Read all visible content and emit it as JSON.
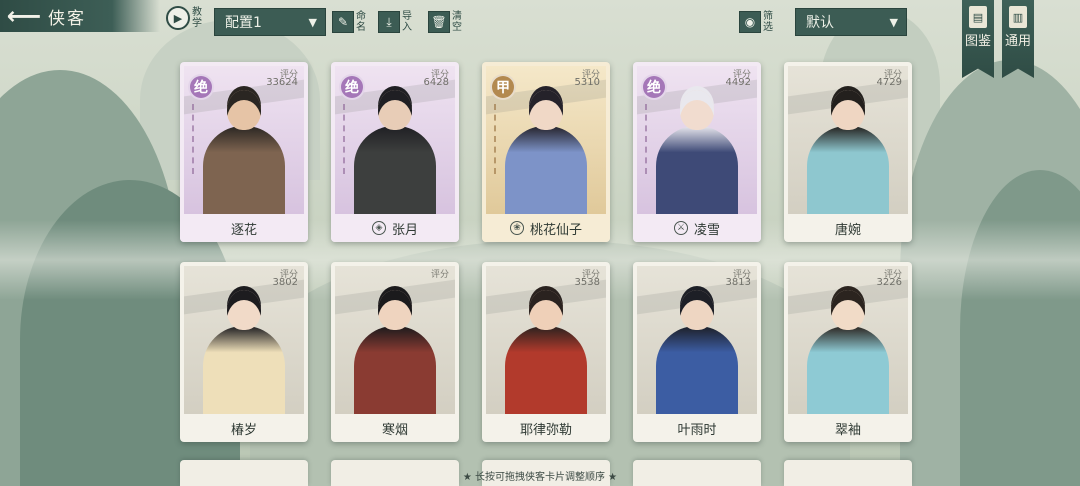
{
  "header": {
    "back_icon": "back-arrow-icon",
    "title": "侠客",
    "tutorial_label": "教学",
    "config_selected": "配置1",
    "rename_label": "命名",
    "import_label": "导入",
    "clear_label": "清空",
    "filter_label": "筛选",
    "sort_selected": "默认",
    "codex_label": "图鉴",
    "general_label": "通用"
  },
  "score_label": "评分",
  "cards": [
    {
      "name": "逐花",
      "score": "33624",
      "rarity": "绝",
      "tier": "purple",
      "badge": "",
      "hair": "#2a2622",
      "skin": "#e6c4a6",
      "cloth": "#7e6450"
    },
    {
      "name": "张月",
      "score": "6428",
      "rarity": "绝",
      "tier": "purple",
      "badge": "shield-icon",
      "hair": "#1f1f23",
      "skin": "#e8cdb7",
      "cloth": "#3d3f3e"
    },
    {
      "name": "桃花仙子",
      "score": "5310",
      "rarity": "甲",
      "tier": "gold",
      "badge": "lotus-icon",
      "hair": "#25222a",
      "skin": "#f0d8c6",
      "cloth": "#7d93c8"
    },
    {
      "name": "凌雪",
      "score": "4492",
      "rarity": "绝",
      "tier": "purple",
      "badge": "sword-icon",
      "hair": "#e9e8ee",
      "skin": "#f1dccf",
      "cloth": "#3e4a77"
    },
    {
      "name": "唐婉",
      "score": "4729",
      "rarity": "",
      "tier": "plain",
      "badge": "",
      "hair": "#23201d",
      "skin": "#efd6c2",
      "cloth": "#8ec7cf"
    },
    {
      "name": "椿岁",
      "score": "3802",
      "rarity": "",
      "tier": "plain",
      "badge": "",
      "hair": "#1d1c1f",
      "skin": "#f1dac8",
      "cloth": "#eedfb9"
    },
    {
      "name": "寒烟",
      "score": "",
      "rarity": "",
      "tier": "plain",
      "badge": "",
      "hair": "#1b1a1c",
      "skin": "#efd4bf",
      "cloth": "#8a3b32"
    },
    {
      "name": "耶律弥勒",
      "score": "3538",
      "rarity": "",
      "tier": "plain",
      "badge": "",
      "hair": "#2a221f",
      "skin": "#efd0b8",
      "cloth": "#b23a2c"
    },
    {
      "name": "叶雨时",
      "score": "3813",
      "rarity": "",
      "tier": "plain",
      "badge": "",
      "hair": "#1d1f26",
      "skin": "#eed6c2",
      "cloth": "#3c5da3"
    },
    {
      "name": "翠袖",
      "score": "3226",
      "rarity": "",
      "tier": "plain",
      "badge": "",
      "hair": "#2b241f",
      "skin": "#f1dbc7",
      "cloth": "#8ecad4"
    }
  ],
  "hint": "★ 长按可拖拽侠客卡片调整顺序 ★"
}
